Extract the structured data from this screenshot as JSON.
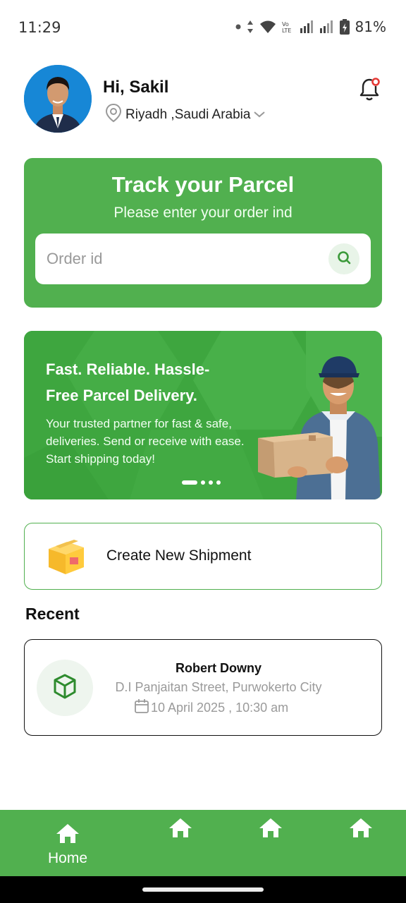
{
  "status_bar": {
    "time": "11:29",
    "battery": "81%",
    "icons": [
      "dot-icon",
      "data-arrows-icon",
      "wifi-icon",
      "volte-icon",
      "signal-icon",
      "signal-icon",
      "battery-icon"
    ]
  },
  "header": {
    "greeting": "Hi, Sakil",
    "location": "Riyadh ,Saudi Arabia",
    "avatar": "user-avatar",
    "notification_icon": "bell-icon"
  },
  "track": {
    "title": "Track your Parcel",
    "subtitle": "Please enter your order ind",
    "placeholder": "Order id",
    "search_icon": "search-icon"
  },
  "banner": {
    "headline_line1": "Fast. Reliable. Hassle-",
    "headline_line2": "Free Parcel Delivery.",
    "body": "Your trusted partner for fast & safe,  deliveries. Send or receive with ease. Start shipping today!",
    "slides_total": 4,
    "active_slide": 1
  },
  "create_shipment": {
    "label": "Create New Shipment",
    "icon": "package-box-icon"
  },
  "recent": {
    "title": "Recent",
    "items": [
      {
        "name": "Robert Downy",
        "address": "D.I Panjaitan Street, Purwokerto City",
        "date": "10 April 2025 , 10:30 am",
        "icon": "cube-icon"
      }
    ]
  },
  "bottom_nav": {
    "items": [
      {
        "label": "Home",
        "icon": "home-icon",
        "active": true
      },
      {
        "label": "",
        "icon": "home-icon",
        "active": false
      },
      {
        "label": "",
        "icon": "home-icon",
        "active": false
      },
      {
        "label": "",
        "icon": "home-icon",
        "active": false
      }
    ]
  },
  "colors": {
    "brand_green": "#51b04f",
    "banner_green": "#3ea63f",
    "muted_text": "#9a9a9a"
  }
}
